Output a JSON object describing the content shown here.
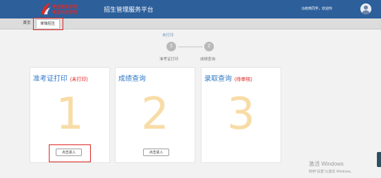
{
  "header": {
    "logo": {
      "line1": "枣庄职业学院",
      "line2": "枣庄科技学院"
    },
    "title": "招生管理服务平台",
    "user_greeting": "马晓燕同学，欢迎你"
  },
  "tabs": [
    {
      "label": "首页"
    },
    {
      "label": "单独招生"
    }
  ],
  "status": {
    "label": "未打印"
  },
  "steps": [
    {
      "number": "1",
      "label": "准考证打印"
    },
    {
      "number": "2",
      "label": "成绩查询"
    }
  ],
  "cards": [
    {
      "title": "准考证打印",
      "badge": "(未打印)",
      "number": "1",
      "button": "点击进入"
    },
    {
      "title": "成绩查询",
      "badge": "",
      "number": "2",
      "button": "点击进入"
    },
    {
      "title": "录取查询",
      "badge": "(待审核)",
      "number": "3",
      "button": ""
    }
  ],
  "watermark": {
    "line1": "激活 Windows",
    "line2": "转到\"设置\"以激活 Windows。"
  },
  "colors": {
    "header": "#2d5f9b",
    "accent": "#2f78c6",
    "alert": "#e02020",
    "card_number": "#f8dca7"
  }
}
